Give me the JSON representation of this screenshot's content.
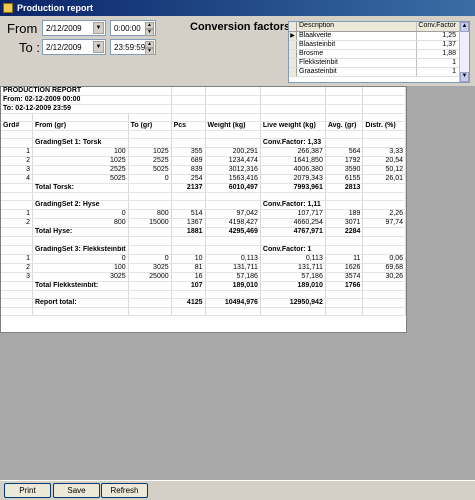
{
  "window": {
    "title": "Production report"
  },
  "filters": {
    "from_label": "From :",
    "to_label": "To :",
    "from_date": "2/12/2009",
    "from_time": "0:00:00",
    "to_date": "2/12/2009",
    "to_time": "23:59:59"
  },
  "conversion": {
    "label": "Conversion factors:",
    "headers": [
      "Description",
      "Conv.Factor"
    ],
    "rows": [
      {
        "desc": "Blaakveite",
        "factor": "1,25"
      },
      {
        "desc": "Blaasteinbit",
        "factor": "1,37"
      },
      {
        "desc": "Brosme",
        "factor": "1,88"
      },
      {
        "desc": "Flekksteinbit",
        "factor": "1"
      },
      {
        "desc": "Graasteinbit",
        "factor": "1"
      }
    ]
  },
  "report": {
    "title": "PRODUCTION REPORT",
    "from": "From: 02-12-2009 00:00",
    "to": "To: 02-12-2009 23:59",
    "headers": [
      "Grd#",
      "From (gr)",
      "To (gr)",
      "Pcs",
      "Weight (kg)",
      "Live weight (kg)",
      "Avg. (gr)",
      "Distr. (%)"
    ],
    "rows": [
      [
        "",
        "",
        "",
        "",
        "",
        "",
        "",
        ""
      ],
      [
        "",
        "GradingSet 1: Torsk",
        "",
        "",
        "",
        "Conv.Factor: 1,33",
        "",
        ""
      ],
      [
        "1",
        "100",
        "1025",
        "355",
        "200,291",
        "266,387",
        "564",
        "3,33"
      ],
      [
        "2",
        "1025",
        "2525",
        "689",
        "1234,474",
        "1641,850",
        "1792",
        "20,54"
      ],
      [
        "3",
        "2525",
        "5025",
        "839",
        "3012,316",
        "4006,380",
        "3590",
        "50,12"
      ],
      [
        "4",
        "5025",
        "0",
        "254",
        "1563,416",
        "2079,343",
        "6155",
        "26,01"
      ],
      [
        "",
        "Total Torsk:",
        "",
        "2137",
        "6010,497",
        "7993,961",
        "2813",
        ""
      ],
      [
        "",
        "",
        "",
        "",
        "",
        "",
        "",
        ""
      ],
      [
        "",
        "GradingSet 2: Hyse",
        "",
        "",
        "",
        "Conv.Factor: 1,11",
        "",
        ""
      ],
      [
        "1",
        "0",
        "800",
        "514",
        "97,042",
        "107,717",
        "189",
        "2,26"
      ],
      [
        "2",
        "800",
        "15000",
        "1367",
        "4198,427",
        "4660,254",
        "3071",
        "97,74"
      ],
      [
        "",
        "Total Hyse:",
        "",
        "1881",
        "4295,469",
        "4767,971",
        "2284",
        ""
      ],
      [
        "",
        "",
        "",
        "",
        "",
        "",
        "",
        ""
      ],
      [
        "",
        "GradingSet 3: Flekksteinbit",
        "",
        "",
        "",
        "Conv.Factor: 1",
        "",
        ""
      ],
      [
        "1",
        "0",
        "0",
        "10",
        "0,113",
        "0,113",
        "11",
        "0,06"
      ],
      [
        "2",
        "100",
        "3025",
        "81",
        "131,711",
        "131,711",
        "1626",
        "69,68"
      ],
      [
        "3",
        "3025",
        "25000",
        "16",
        "57,186",
        "57,186",
        "3574",
        "30,26"
      ],
      [
        "",
        "Total Flekksteinbit:",
        "",
        "107",
        "189,010",
        "189,010",
        "1766",
        ""
      ],
      [
        "",
        "",
        "",
        "",
        "",
        "",
        "",
        ""
      ],
      [
        "",
        "Report total:",
        "",
        "4125",
        "10494,976",
        "12950,942",
        "",
        ""
      ],
      [
        "",
        "",
        "",
        "",
        "",
        "",
        "",
        ""
      ]
    ],
    "bold_rows": [
      1,
      6,
      8,
      11,
      13,
      17,
      19
    ]
  },
  "buttons": {
    "print": "Print",
    "save": "Save",
    "refresh": "Refresh"
  }
}
